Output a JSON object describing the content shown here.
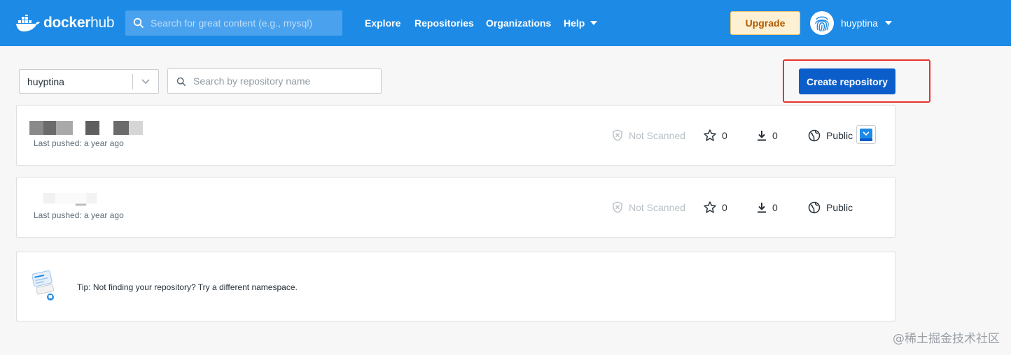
{
  "header": {
    "logo_icon": "docker-whale-icon",
    "logo_text_bold": "docker",
    "logo_text_light": "hub",
    "search_placeholder": "Search for great content (e.g., mysql)",
    "nav": [
      "Explore",
      "Repositories",
      "Organizations",
      "Help"
    ],
    "upgrade_label": "Upgrade",
    "username": "huyptina",
    "avatar_icon": "fingerprint-icon"
  },
  "toolbar": {
    "namespace": "huyptina",
    "search_placeholder": "Search by repository name",
    "create_label": "Create repository"
  },
  "repositories": [
    {
      "pushed": "Last pushed: a year ago",
      "scan_status": "Not Scanned",
      "stars": "0",
      "pulls": "0",
      "visibility": "Public",
      "has_badge": true
    },
    {
      "pushed": "Last pushed: a year ago",
      "scan_status": "Not Scanned",
      "stars": "0",
      "pulls": "0",
      "visibility": "Public",
      "has_badge": false
    }
  ],
  "tip": {
    "text": "Tip: Not finding your repository? Try a different namespace."
  },
  "watermark": "@稀土掘金技术社区",
  "colors": {
    "header_blue": "#1d8ae6",
    "primary_button": "#0b5ec9",
    "highlight_red": "#e8332b",
    "upgrade_bg": "#fdf0d3"
  }
}
